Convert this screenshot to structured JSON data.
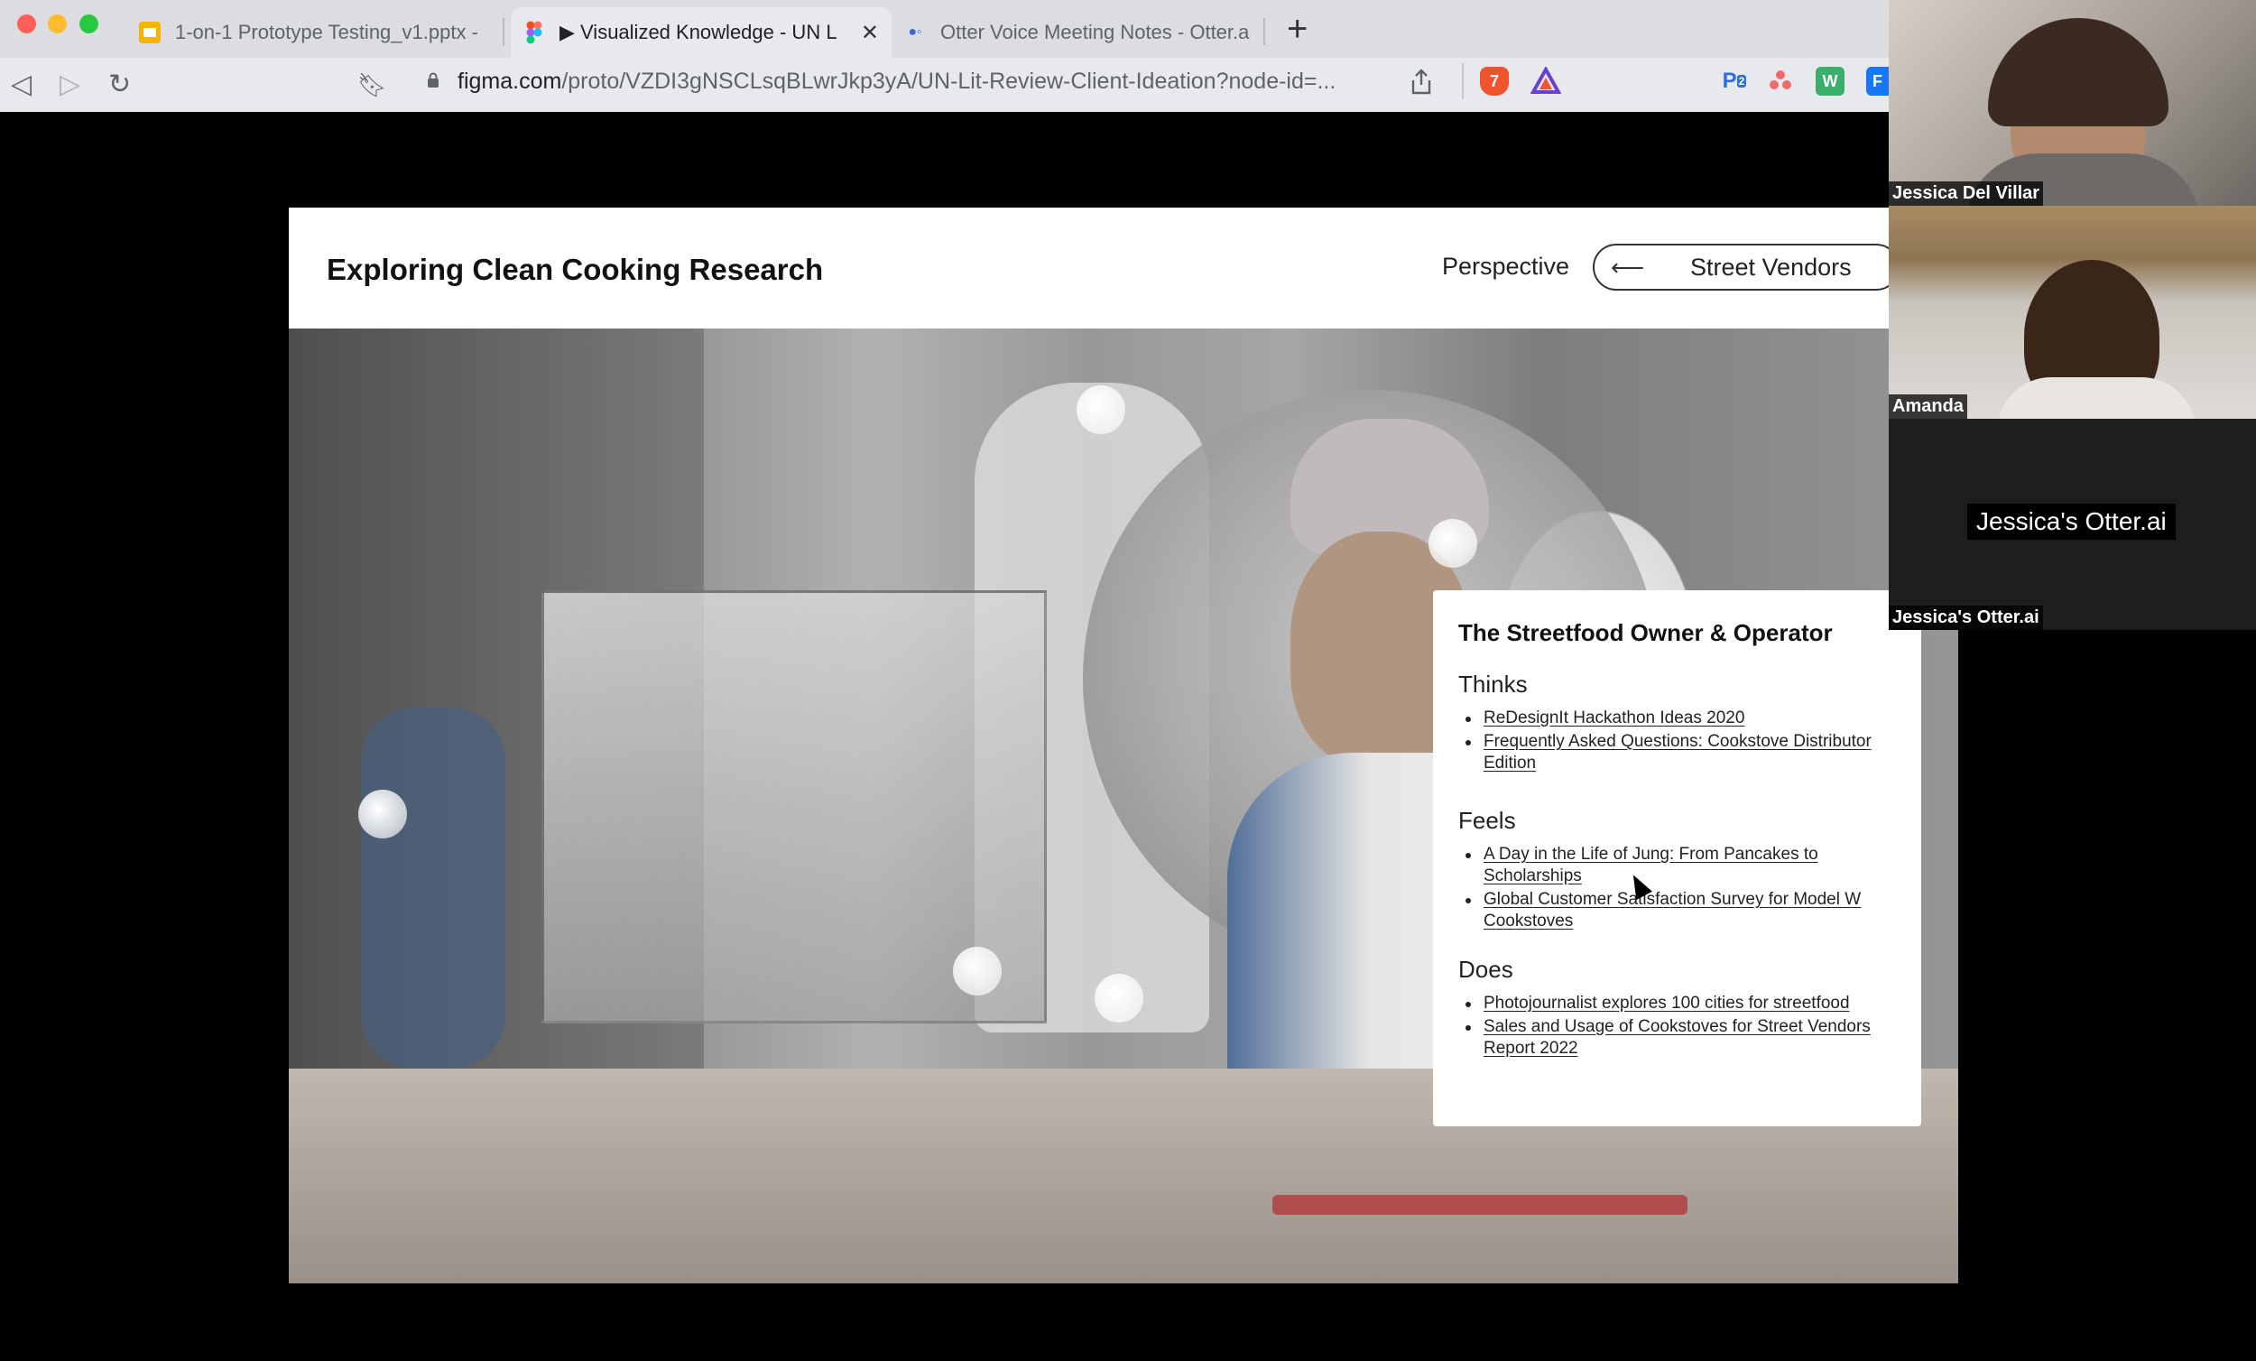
{
  "browser": {
    "tabs": [
      {
        "title": "1-on-1 Prototype Testing_v1.pptx -",
        "favicon": "slides-icon",
        "active": false
      },
      {
        "title": "▶ Visualized Knowledge - UN L",
        "favicon": "figma-icon",
        "active": true
      },
      {
        "title": "Otter Voice Meeting Notes - Otter.a",
        "favicon": "otter-icon",
        "active": false
      }
    ],
    "url_host": "figma.com",
    "url_path": "/proto/VZDI3gNSCLsqBLwrJkp3yA/UN-Lit-Review-Client-Ideation?node-id=...",
    "extensions": [
      {
        "label": "7",
        "icon": "brave-shield-icon",
        "color": "#f0542e"
      },
      {
        "label": "",
        "icon": "brave-rewards-icon",
        "color": "#6b3fd4"
      },
      {
        "label": "2",
        "icon": "extension-p-icon",
        "color": "#2f6fd8"
      },
      {
        "label": "",
        "icon": "asana-icon",
        "color": "#f06a6a"
      },
      {
        "label": "",
        "icon": "extension-w-icon",
        "color": "#3aae6b"
      },
      {
        "label": "F",
        "icon": "extension-f-icon",
        "color": "#1877f2"
      }
    ]
  },
  "prototype": {
    "title": "Exploring Clean Cooking Research",
    "perspective_label": "Perspective",
    "perspective_value": "Street Vendors",
    "persona": {
      "title": "The Streetfood Owner & Operator",
      "sections": [
        {
          "heading": "Thinks",
          "links": [
            "ReDesignIt Hackathon Ideas 2020",
            "Frequently Asked Questions: Cookstove Distributor Edition"
          ]
        },
        {
          "heading": "Feels",
          "links": [
            "A Day in the Life of Jung: From Pancakes to Scholarships",
            "Global Customer Satisfaction Survey for Model W Cookstoves"
          ]
        },
        {
          "heading": "Does",
          "links": [
            "Photojournalist explores 100 cities for streetfood",
            "Sales and Usage of Cookstoves for Street Vendors Report 2022"
          ]
        }
      ]
    }
  },
  "participants": [
    {
      "name": "Jessica Del Villar"
    },
    {
      "name": "Amanda"
    },
    {
      "name": "Jessica's Otter.ai",
      "center_label": "Jessica's Otter.ai"
    }
  ]
}
